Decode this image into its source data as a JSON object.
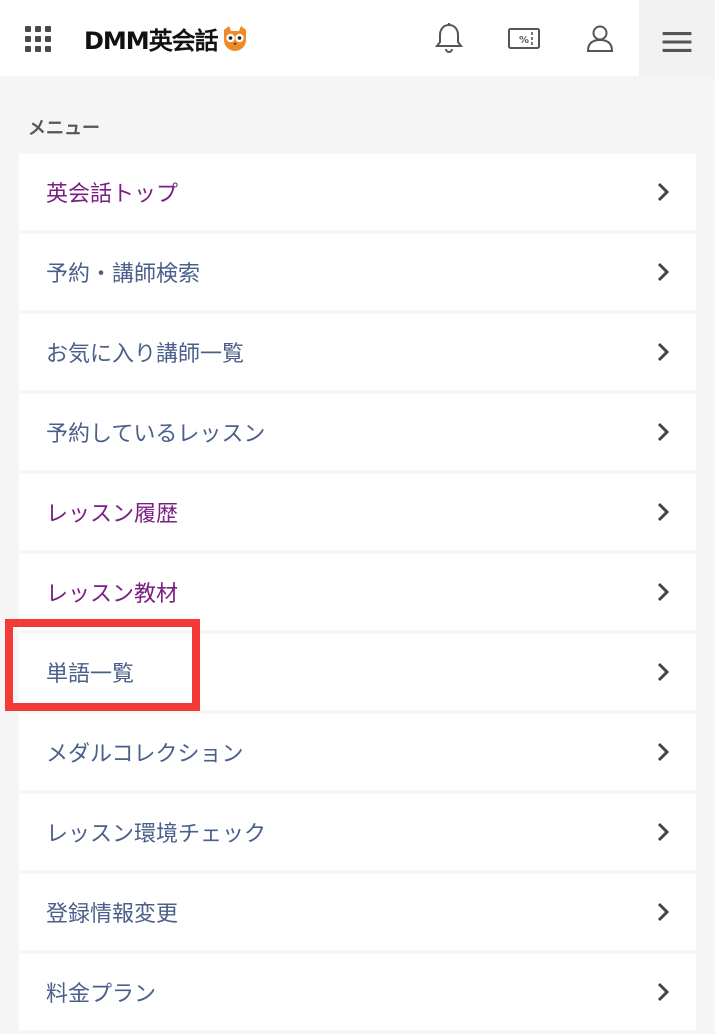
{
  "header": {
    "logo_text": "DMM英会話",
    "icons": [
      "apps-grid-icon",
      "owl-logo-icon",
      "bell-icon",
      "coupon-icon",
      "user-icon",
      "hamburger-menu-icon"
    ]
  },
  "menu": {
    "title": "メニュー",
    "items": [
      {
        "label": "英会話トップ",
        "color": "#7b1f82"
      },
      {
        "label": "予約・講師検索",
        "color": "#4a5f8a"
      },
      {
        "label": "お気に入り講師一覧",
        "color": "#4a5f8a"
      },
      {
        "label": "予約しているレッスン",
        "color": "#4a5f8a"
      },
      {
        "label": "レッスン履歴",
        "color": "#7b1f82"
      },
      {
        "label": "レッスン教材",
        "color": "#7b1f82"
      },
      {
        "label": "単語一覧",
        "color": "#4a5f8a"
      },
      {
        "label": "メダルコレクション",
        "color": "#4a5f8a"
      },
      {
        "label": "レッスン環境チェック",
        "color": "#4a5f8a"
      },
      {
        "label": "登録情報変更",
        "color": "#4a5f8a"
      },
      {
        "label": "料金プラン",
        "color": "#4a5f8a"
      }
    ]
  },
  "colors": {
    "highlight": "#f23b36",
    "owl": "#f08a24"
  }
}
